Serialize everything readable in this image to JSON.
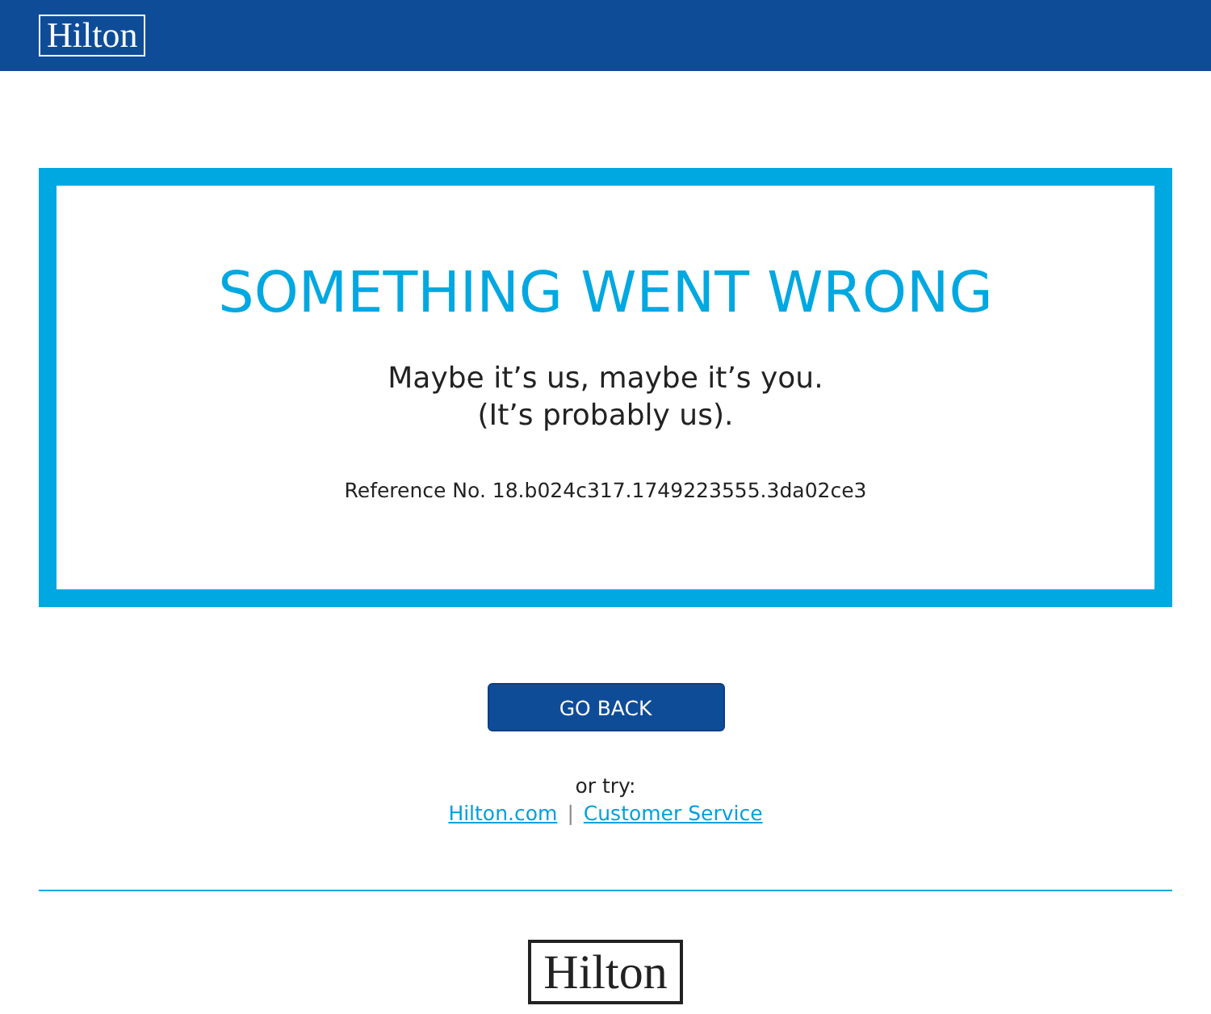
{
  "header": {
    "logo": "Hilton"
  },
  "error": {
    "title": "SOMETHING WENT WRONG",
    "message_lines": [
      "Maybe it’s us, maybe it’s you.",
      "(It’s probably us)."
    ],
    "reference": "Reference No. 18.b024c317.1749223555.3da02ce3"
  },
  "button": "GO BACK",
  "alternatives": {
    "label": "or try:",
    "links": [
      "Hilton.com",
      "Customer Service"
    ],
    "separator": "|"
  },
  "footer": {
    "logo": "Hilton"
  }
}
